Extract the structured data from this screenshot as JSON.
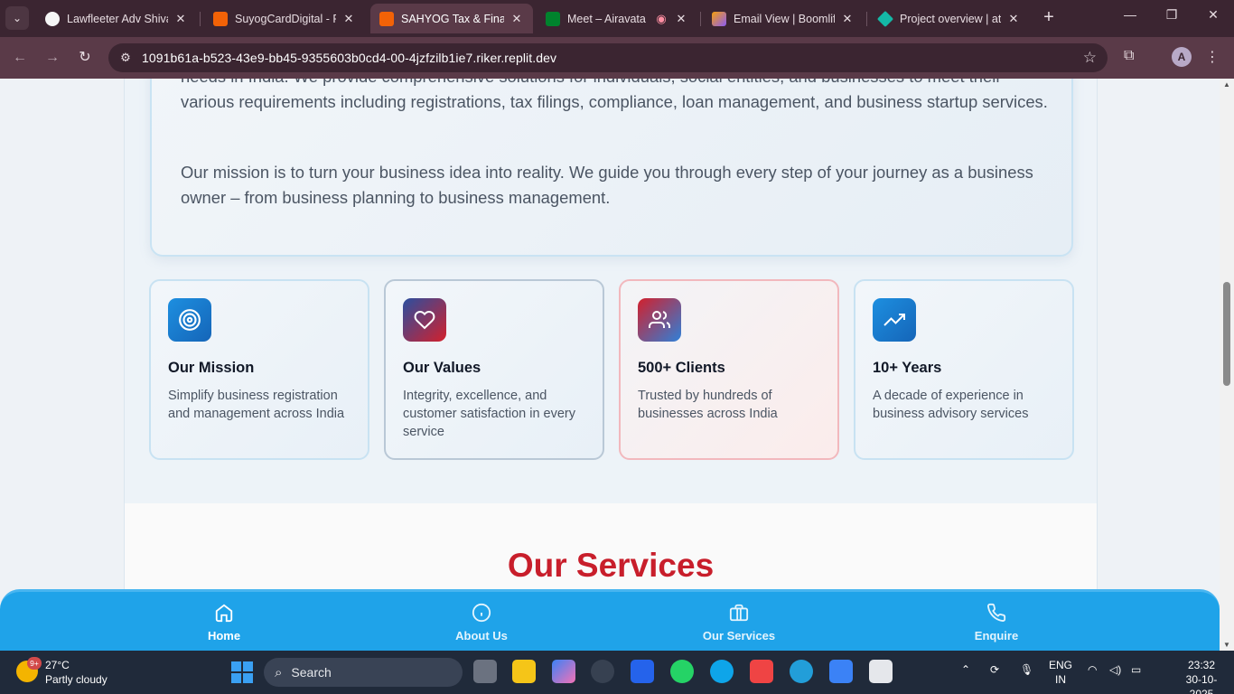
{
  "browser": {
    "tabs": [
      {
        "title": "Lawfleeter Adv Shivar",
        "favicon_color": "#f5f5f5"
      },
      {
        "title": "SuyogCardDigital - Re",
        "favicon_color": "#f26207"
      },
      {
        "title": "SAHYOG Tax & Financ",
        "favicon_color": "#f26207"
      },
      {
        "title": "Meet – Airavata M",
        "favicon_color": "#00832d"
      },
      {
        "title": "Email View | Boomlify",
        "favicon_color": "#8b5cf6"
      },
      {
        "title": "Project overview | atd",
        "favicon_color": "#14b8a6"
      }
    ],
    "active_tab": 2,
    "url": "1091b61a-b523-43e9-bb45-9355603b0cd4-00-4jzfzilb1ie7.riker.replit.dev",
    "profile_initial": "A"
  },
  "about": {
    "paragraph1": "needs in India. We provide comprehensive solutions for individuals, social entities, and businesses to meet their various requirements including registrations, tax filings, compliance, loan management, and business startup services.",
    "paragraph2": "Our mission is to turn your business idea into reality. We guide you through every step of your journey as a business owner – from business planning to business management."
  },
  "features": [
    {
      "icon": "target-icon",
      "title": "Our Mission",
      "desc": "Simplify business registration and management across India"
    },
    {
      "icon": "heart-icon",
      "title": "Our Values",
      "desc": "Integrity, excellence, and customer satisfaction in every service"
    },
    {
      "icon": "users-icon",
      "title": "500+ Clients",
      "desc": "Trusted by hundreds of businesses across India"
    },
    {
      "icon": "trending-up-icon",
      "title": "10+ Years",
      "desc": "A decade of experience in business advisory services"
    }
  ],
  "services": {
    "title": "Our Services"
  },
  "bottom_nav": [
    {
      "icon": "home-icon",
      "label": "Home",
      "active": true
    },
    {
      "icon": "info-icon",
      "label": "About Us",
      "active": false
    },
    {
      "icon": "briefcase-icon",
      "label": "Our Services",
      "active": false
    },
    {
      "icon": "phone-icon",
      "label": "Enquire",
      "active": false
    }
  ],
  "taskbar": {
    "weather_badge": "9+",
    "temperature": "27°C",
    "condition": "Partly cloudy",
    "search_placeholder": "Search",
    "language": "ENG",
    "region": "IN",
    "time": "23:32",
    "date": "30-10-2025"
  },
  "colors": {
    "accent_blue": "#1fa3e9",
    "services_red": "#c81e2b",
    "browser_frame": "#3b2531"
  }
}
